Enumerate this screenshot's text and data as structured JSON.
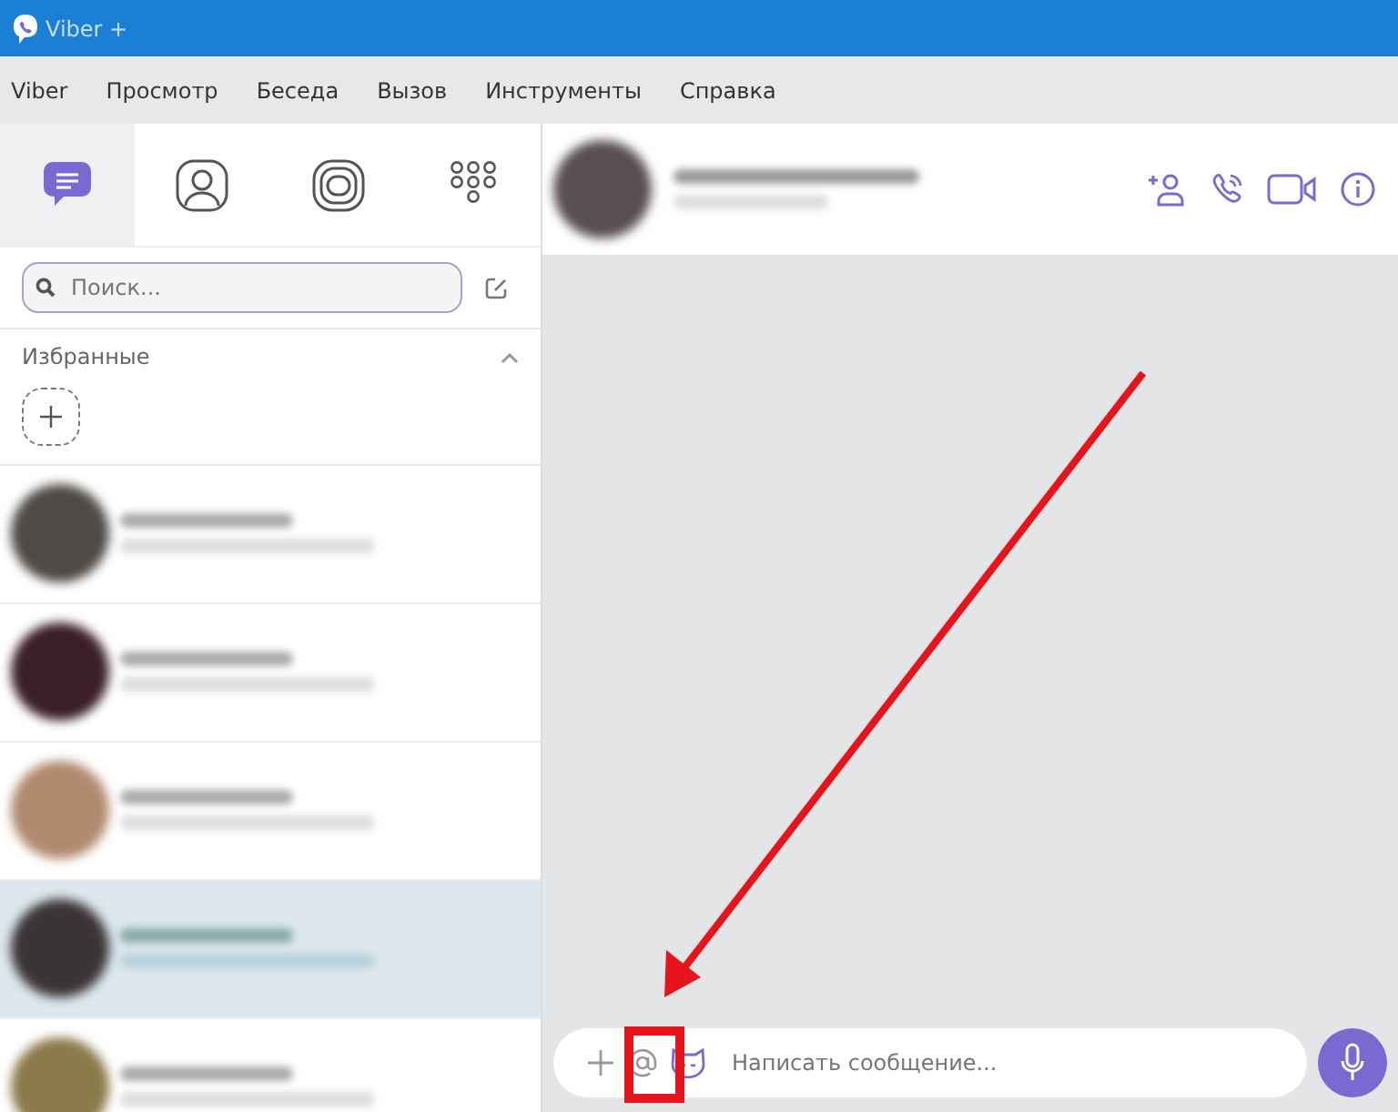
{
  "window": {
    "title": "Viber +"
  },
  "menu": [
    "Viber",
    "Просмотр",
    "Беседа",
    "Вызов",
    "Инструменты",
    "Справка"
  ],
  "nav_tabs": [
    {
      "kind": "chats",
      "selected": true
    },
    {
      "kind": "contacts",
      "selected": false
    },
    {
      "kind": "stories",
      "selected": false
    },
    {
      "kind": "keypad",
      "selected": false
    }
  ],
  "search": {
    "placeholder": "Поиск..."
  },
  "favorites": {
    "title": "Избранные",
    "expanded": true
  },
  "chats": [
    {
      "selected": false
    },
    {
      "selected": false
    },
    {
      "selected": false
    },
    {
      "selected": true
    },
    {
      "selected": false
    }
  ],
  "composer": {
    "placeholder": "Написать сообщение..."
  },
  "annotations": {
    "arrow": true,
    "highlight_box": true
  }
}
